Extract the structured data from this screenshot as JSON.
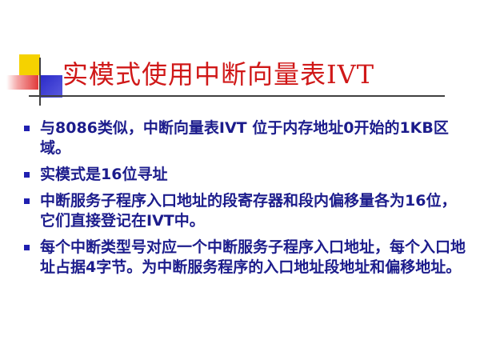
{
  "slide": {
    "title": "实模式使用中断向量表IVT",
    "bullets": [
      "与8086类似，中断向量表IVT 位于内存地址0开始的1KB区域。",
      "实模式是16位寻址",
      "中断服务子程序入口地址的段寄存器和段内偏移量各为16位，它们直接登记在IVT中。",
      "每个中断类型号对应一个中断服务子程序入口地址，每个入口地址占据4字节。为中断服务程序的入口地址段地址和偏移地址。"
    ]
  },
  "colors": {
    "title": "#d01818",
    "bullet_text": "#1c1c8c",
    "bullet_marker": "#2020b0",
    "deco_yellow": "#f5d200",
    "deco_red": "#e23a3a",
    "deco_blue": "#2a2ac8"
  }
}
